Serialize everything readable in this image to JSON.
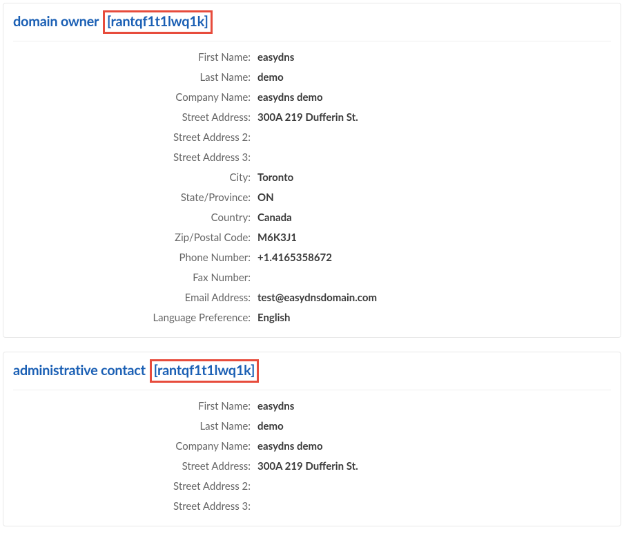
{
  "colors": {
    "accent": "#1a5fb4",
    "highlight_border": "#e74c3c"
  },
  "sections": [
    {
      "title": "domain owner",
      "id_bracket": "[rantqf1t1lwq1k]",
      "highlight": true,
      "fields": [
        {
          "label": "First Name",
          "value": "easydns"
        },
        {
          "label": "Last Name",
          "value": "demo"
        },
        {
          "label": "Company Name",
          "value": "easydns demo"
        },
        {
          "label": "Street Address",
          "value": "300A 219 Dufferin St."
        },
        {
          "label": "Street Address 2",
          "value": ""
        },
        {
          "label": "Street Address 3",
          "value": ""
        },
        {
          "label": "City",
          "value": "Toronto"
        },
        {
          "label": "State/Province",
          "value": "ON"
        },
        {
          "label": "Country",
          "value": "Canada"
        },
        {
          "label": "Zip/Postal Code",
          "value": "M6K3J1"
        },
        {
          "label": "Phone Number",
          "value": "+1.4165358672"
        },
        {
          "label": "Fax Number",
          "value": ""
        },
        {
          "label": "Email Address",
          "value": "test@easydnsdomain.com"
        },
        {
          "label": "Language Preference",
          "value": "English"
        }
      ]
    },
    {
      "title": "administrative contact",
      "id_bracket": "[rantqf1t1lwq1k]",
      "highlight": true,
      "fields": [
        {
          "label": "First Name",
          "value": "easydns"
        },
        {
          "label": "Last Name",
          "value": "demo"
        },
        {
          "label": "Company Name",
          "value": "easydns demo"
        },
        {
          "label": "Street Address",
          "value": "300A 219 Dufferin St."
        },
        {
          "label": "Street Address 2",
          "value": ""
        },
        {
          "label": "Street Address 3",
          "value": ""
        }
      ]
    }
  ]
}
